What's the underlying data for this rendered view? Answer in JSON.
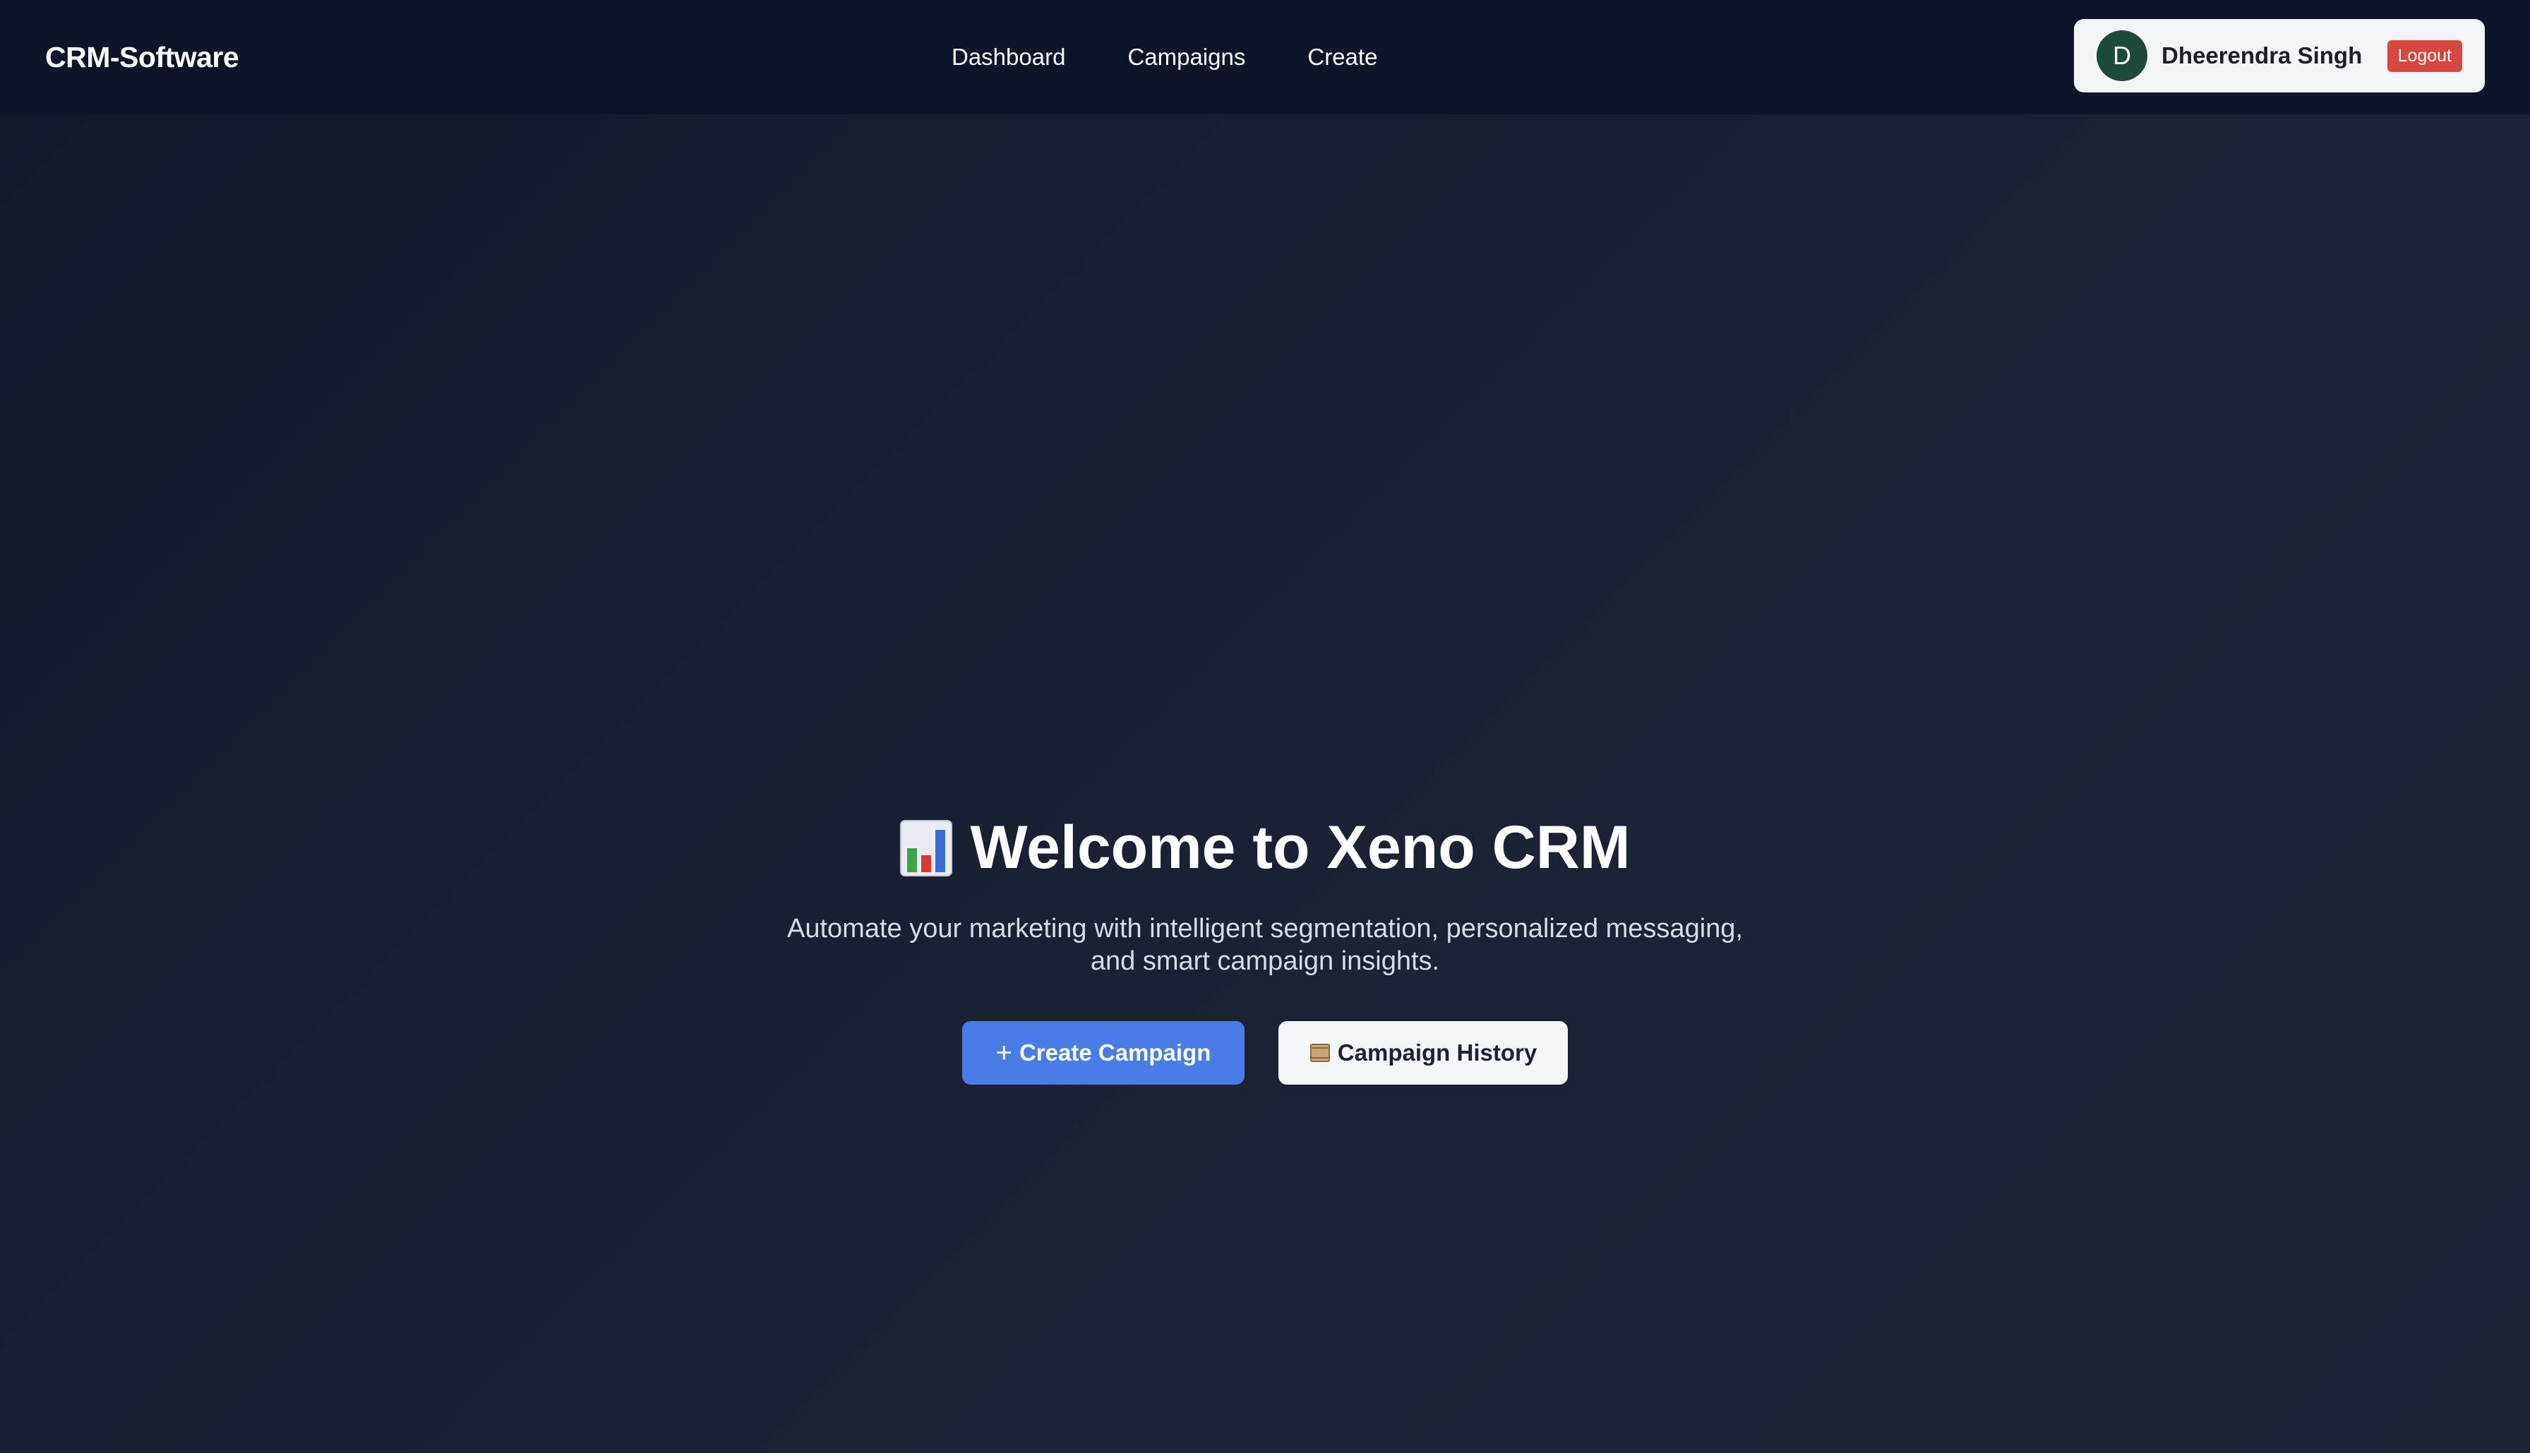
{
  "navbar": {
    "brand": "CRM-Software",
    "links": [
      {
        "label": "Dashboard"
      },
      {
        "label": "Campaigns"
      },
      {
        "label": "Create"
      }
    ],
    "user": {
      "avatar_initial": "D",
      "name": "Dheerendra Singh",
      "logout_label": "Logout"
    }
  },
  "hero": {
    "title_icon": "bar-chart-icon",
    "title": "Welcome to Xeno CRM",
    "subtitle": "Automate your marketing with intelligent segmentation, personalized messaging, and smart campaign insights.",
    "primary_button": {
      "icon": "plus-icon",
      "glyph": "+",
      "label": "Create Campaign"
    },
    "secondary_button": {
      "icon": "scroll-icon",
      "label": "Campaign History"
    }
  },
  "colors": {
    "background": "#1a2134",
    "navbar": "#0f1528",
    "primary_button": "#4a7ce8",
    "logout": "#d9463f",
    "avatar": "#1d4a3a"
  }
}
